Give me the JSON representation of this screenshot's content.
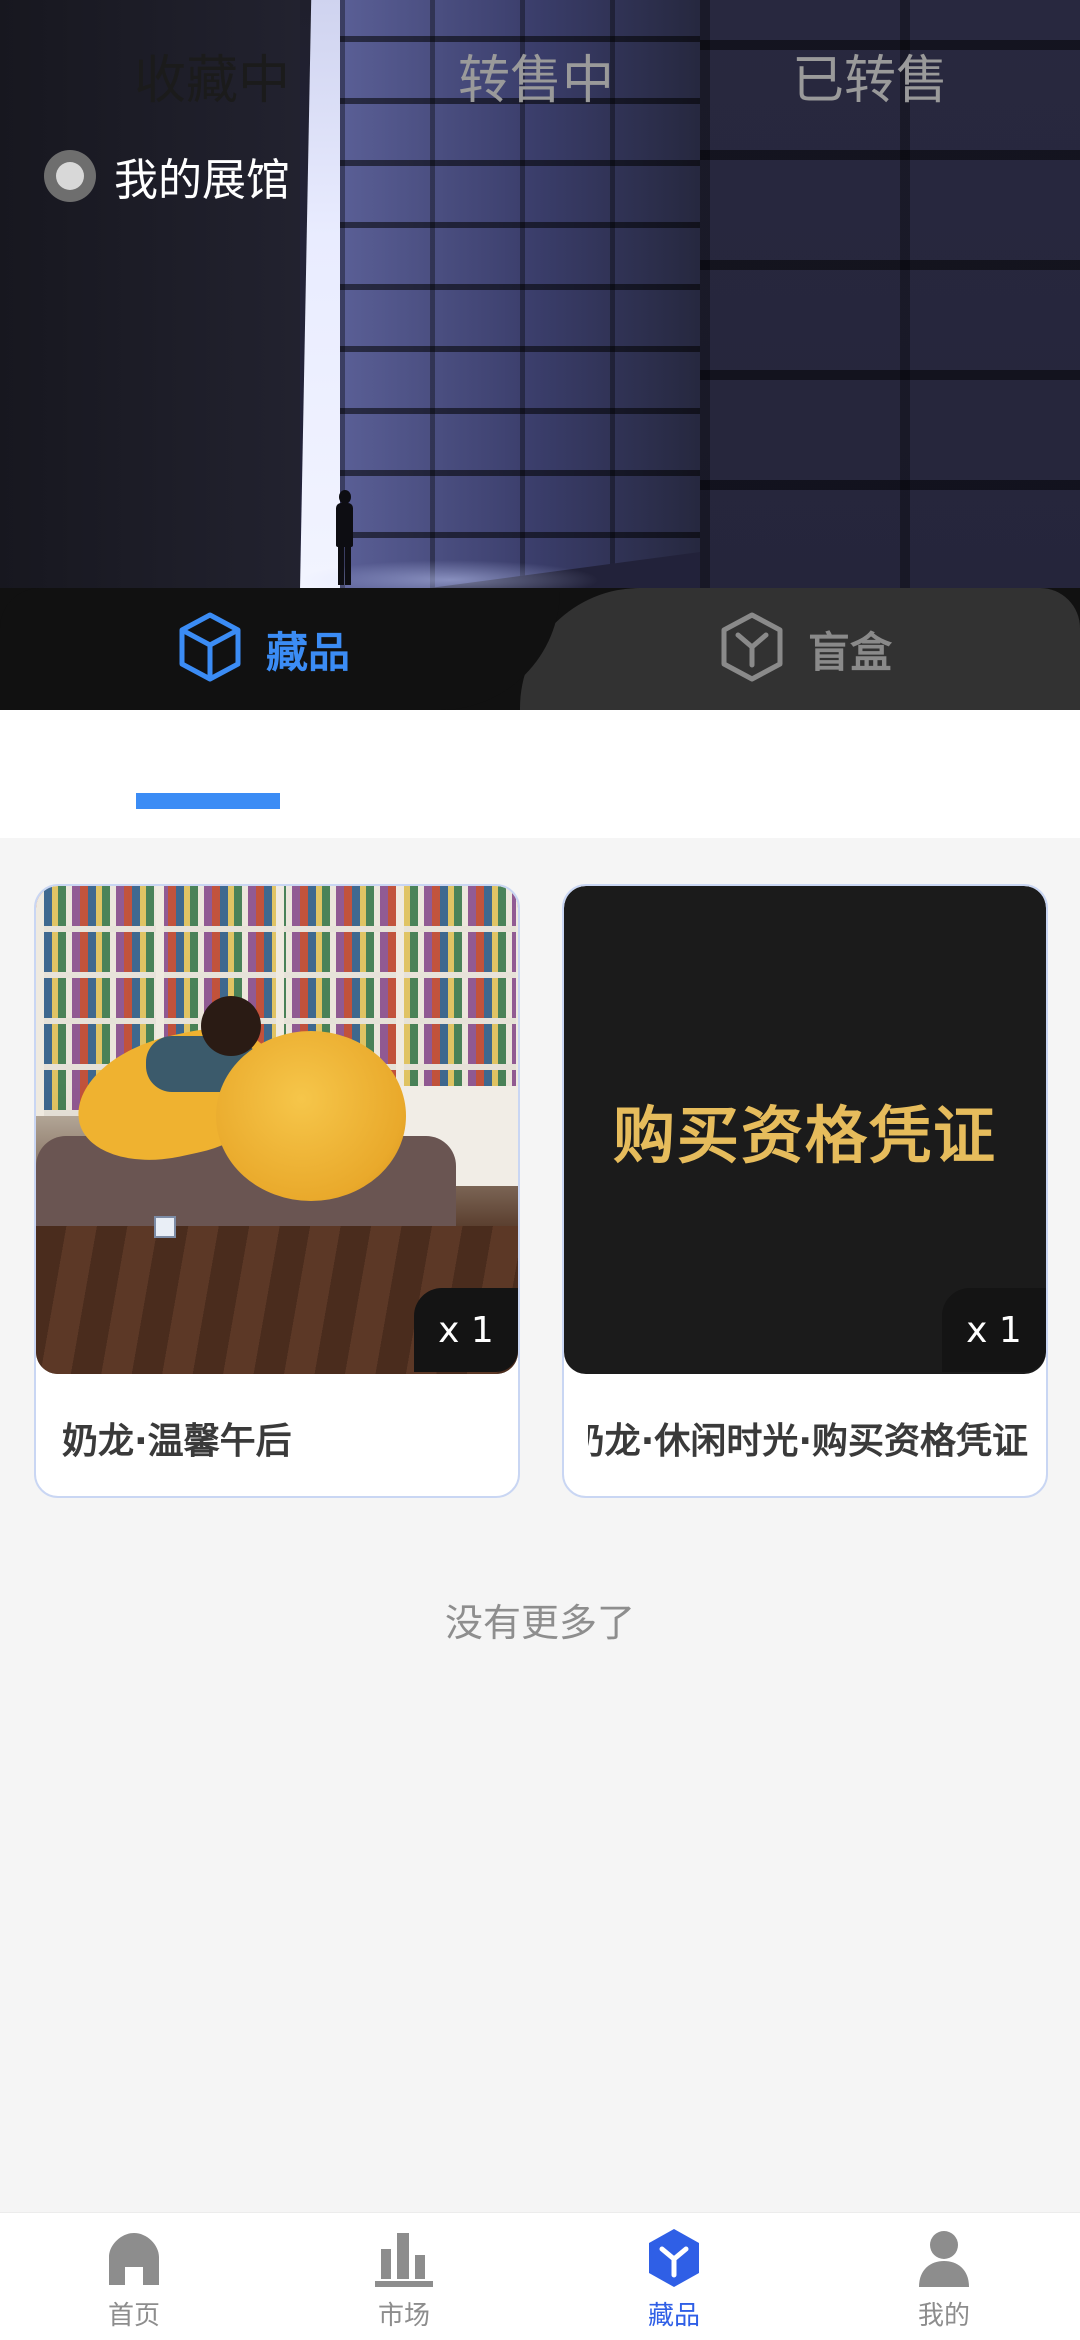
{
  "hero": {
    "gallery_title": "我的展馆"
  },
  "category_tabs": [
    {
      "label": "藏品",
      "icon": "cube-icon",
      "active": true
    },
    {
      "label": "盲盒",
      "icon": "blindbox-icon",
      "active": false
    }
  ],
  "sub_tabs": [
    {
      "label": "收藏中",
      "active": true
    },
    {
      "label": "转售中",
      "active": false
    },
    {
      "label": "已转售",
      "active": false
    }
  ],
  "items": [
    {
      "name": "奶龙·温馨午后",
      "quantity": "x 1"
    },
    {
      "name": "奶龙·休闲时光·购买资格凭证",
      "quantity": "x 1",
      "image_text": "购买资格凭证"
    }
  ],
  "footer_text": "没有更多了",
  "bottom_nav": [
    {
      "label": "首页",
      "icon": "home-icon",
      "active": false
    },
    {
      "label": "市场",
      "icon": "market-chart-icon",
      "active": false
    },
    {
      "label": "藏品",
      "icon": "collection-cube-icon",
      "active": true
    },
    {
      "label": "我的",
      "icon": "profile-icon",
      "active": false
    }
  ],
  "colors": {
    "accent": "#3b8cf5",
    "nav_active": "#2f5fe6",
    "art_gold": "#e6bc5c"
  }
}
